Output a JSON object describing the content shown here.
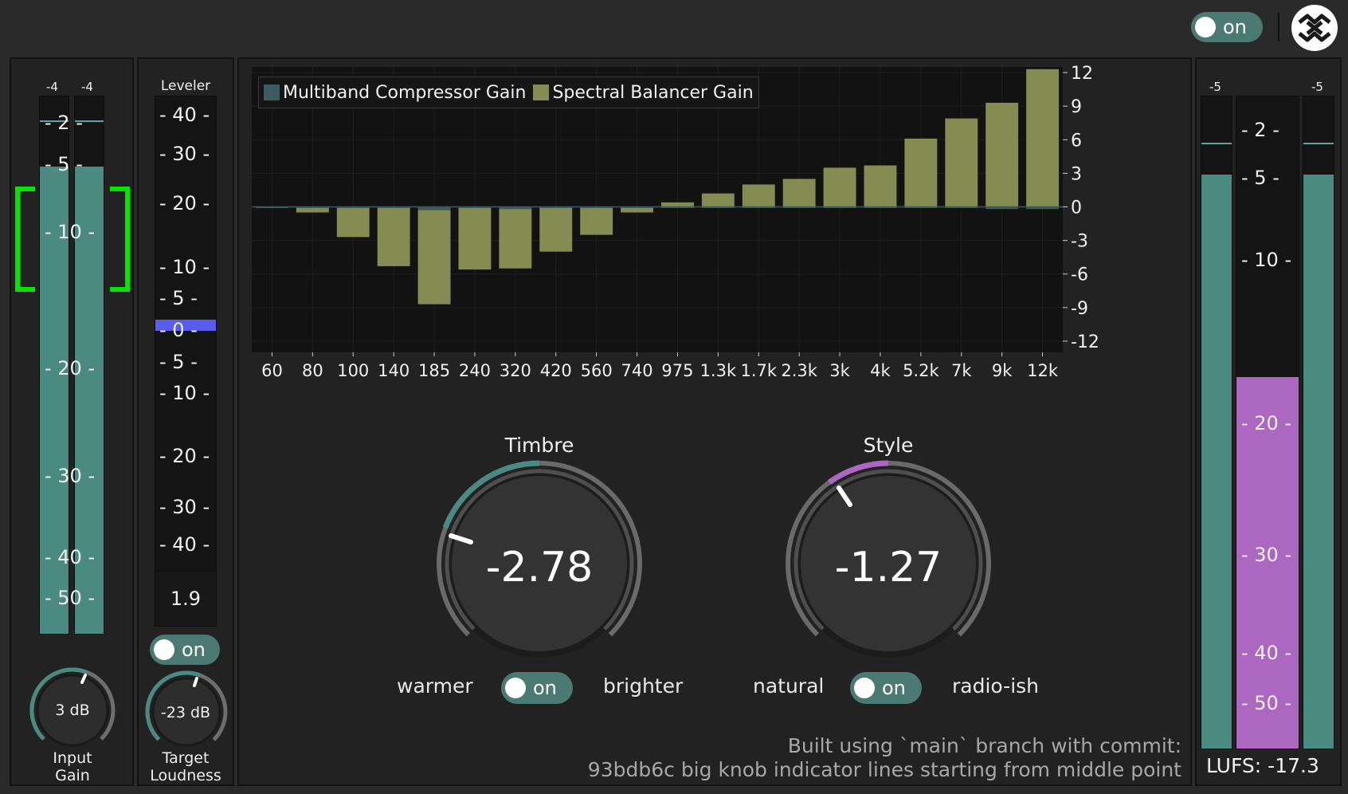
{
  "power": {
    "label": "on"
  },
  "logo": {
    "icon": "chain-link-logo-icon"
  },
  "input_meter": {
    "peak_left": "-4",
    "peak_right": "-4",
    "scale": [
      "- 2 -",
      "- 5 -",
      "- 10 -",
      "- 20 -",
      "- 30 -",
      "- 40 -",
      "- 50 -"
    ],
    "level_left": 0.87,
    "level_right": 0.87,
    "knob_value": "3 dB",
    "knob_label_1": "Input",
    "knob_label_2": "Gain",
    "target_bracket_color": "#00e600"
  },
  "leveler": {
    "title": "Leveler",
    "scale": [
      "- 40 -",
      "- 30 -",
      "- 20 -",
      "- 10 -",
      "- 5 -",
      "- 0 -",
      "- 5 -",
      "- 10 -",
      "- 20 -",
      "- 30 -",
      "- 40 -"
    ],
    "readout": "1.9",
    "toggle_label": "on",
    "knob_value": "-23 dB",
    "knob_label_1": "Target",
    "knob_label_2": "Loudness",
    "gain_bar_color": "#5a5cf0"
  },
  "chart_data": {
    "type": "bar",
    "legend": [
      {
        "name": "Multiband Compressor Gain",
        "color": "#3d5a5e"
      },
      {
        "name": "Spectral Balancer Gain",
        "color": "#858c52"
      }
    ],
    "legend_position": "top-left",
    "categories": [
      "60",
      "80",
      "100",
      "140",
      "185",
      "240",
      "320",
      "420",
      "560",
      "740",
      "975",
      "1.3k",
      "1.7k",
      "2.3k",
      "3k",
      "4k",
      "5.2k",
      "7k",
      "9k",
      "12k"
    ],
    "series": [
      {
        "name": "Spectral Balancer Gain",
        "values": [
          -0.1,
          -0.5,
          -2.7,
          -5.3,
          -8.7,
          -5.6,
          -5.5,
          -4.0,
          -2.5,
          -0.5,
          0.4,
          1.2,
          2.0,
          2.5,
          3.5,
          3.7,
          6.1,
          7.9,
          9.3,
          12.3
        ]
      },
      {
        "name": "Multiband Compressor Gain",
        "values": [
          0,
          0,
          0,
          0,
          -0.3,
          0,
          -0.2,
          0,
          0,
          0,
          0,
          0,
          0,
          0,
          0,
          0,
          -0.1,
          -0.1,
          -0.2,
          -0.2
        ]
      }
    ],
    "y_ticks": [
      "12",
      "9",
      "6",
      "3",
      "0",
      "-3",
      "-6",
      "-9",
      "-12"
    ],
    "ylim": [
      -13,
      12.5
    ],
    "grid": true
  },
  "timbre": {
    "title": "Timbre",
    "value_text": "-2.78",
    "left_label": "warmer",
    "right_label": "brighter",
    "toggle_label": "on",
    "accent": "#4a8a80",
    "value": -2.78,
    "range": [
      -10,
      10
    ]
  },
  "style": {
    "title": "Style",
    "value_text": "-1.27",
    "left_label": "natural",
    "right_label": "radio-ish",
    "toggle_label": "on",
    "accent": "#b069c0",
    "value": -1.27,
    "range": [
      -10,
      10
    ]
  },
  "build_info": {
    "line1": "Built using `main` branch with commit:",
    "line2": "93bdb6c big knob indicator lines starting from middle point"
  },
  "output_meter": {
    "peak_left": "-5",
    "peak_right": "-5",
    "scale": [
      "- 2 -",
      "- 5 -",
      "- 10 -",
      "- 20 -",
      "- 30 -",
      "- 40 -",
      "- 50 -"
    ],
    "level_left": 0.88,
    "level_right": 0.88,
    "loudness_level": 0.57,
    "lufs_label": "LUFS: -17.3",
    "loudness_color": "#ac68c0"
  }
}
